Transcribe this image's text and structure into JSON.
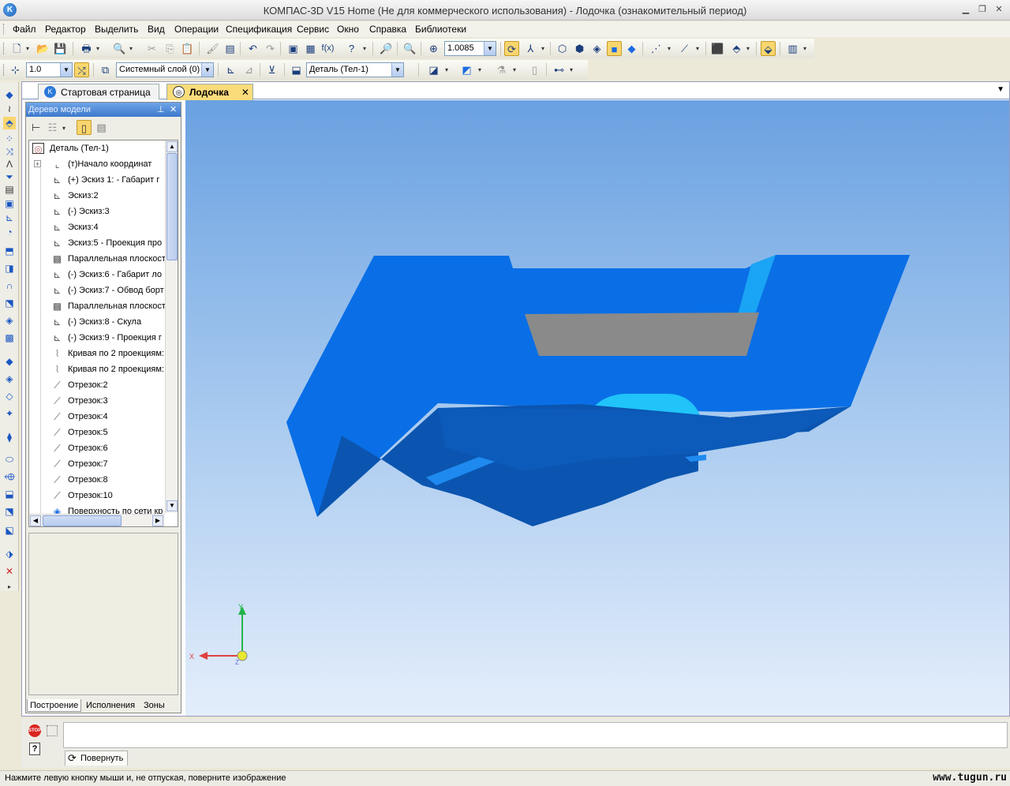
{
  "window": {
    "title": "КОМПАС-3D V15 Home (Не для коммерческого использования) - Лодочка (ознакомительный период)",
    "app_icon": "kompas-logo-icon"
  },
  "menu": [
    "Файл",
    "Редактор",
    "Выделить",
    "Вид",
    "Операции",
    "Спецификация",
    "Сервис",
    "Окно",
    "Справка",
    "Библиотеки"
  ],
  "toolbar1": {
    "zoom_value": "1.0085"
  },
  "toolbar2": {
    "scale_value": "1.0",
    "layer_value": "Системный слой (0)",
    "object_value": "Деталь (Тел-1)"
  },
  "tabs": [
    {
      "label": "Стартовая страница",
      "active": false
    },
    {
      "label": "Лодочка",
      "active": true
    }
  ],
  "tree_panel": {
    "title": "Дерево модели",
    "root": "Деталь (Тел-1)",
    "items": [
      {
        "label": "(т)Начало координат",
        "icon": "axes-icon"
      },
      {
        "label": "(+) Эскиз 1: - Габарит г",
        "icon": "sketch-icon"
      },
      {
        "label": "Эскиз:2",
        "icon": "sketch-icon"
      },
      {
        "label": "(-) Эскиз:3",
        "icon": "sketch-icon"
      },
      {
        "label": "Эскиз:4",
        "icon": "sketch-icon"
      },
      {
        "label": "Эскиз:5 - Проекция про",
        "icon": "sketch-icon"
      },
      {
        "label": "Параллельная плоскост",
        "icon": "plane-icon"
      },
      {
        "label": "(-) Эскиз:6 - Габарит ло",
        "icon": "sketch-icon"
      },
      {
        "label": "(-) Эскиз:7 - Обвод борт",
        "icon": "sketch-icon"
      },
      {
        "label": "Параллельная плоскост",
        "icon": "plane-icon"
      },
      {
        "label": "(-) Эскиз:8 - Скула",
        "icon": "sketch-icon"
      },
      {
        "label": "(-) Эскиз:9 - Проекция г",
        "icon": "sketch-icon"
      },
      {
        "label": "Кривая по 2 проекциям:",
        "icon": "curve-icon"
      },
      {
        "label": "Кривая по 2 проекциям:",
        "icon": "curve-icon"
      },
      {
        "label": "Отрезок:2",
        "icon": "segment-icon"
      },
      {
        "label": "Отрезок:3",
        "icon": "segment-icon"
      },
      {
        "label": "Отрезок:4",
        "icon": "segment-icon"
      },
      {
        "label": "Отрезок:5",
        "icon": "segment-icon"
      },
      {
        "label": "Отрезок:6",
        "icon": "segment-icon"
      },
      {
        "label": "Отрезок:7",
        "icon": "segment-icon"
      },
      {
        "label": "Отрезок:8",
        "icon": "segment-icon"
      },
      {
        "label": "Отрезок:10",
        "icon": "segment-icon"
      },
      {
        "label": "Поверхность по сети кр",
        "icon": "surface-icon"
      }
    ],
    "bottom_tabs": [
      "Построение",
      "Исполнения",
      "Зоны"
    ]
  },
  "axis": {
    "x_label": "X",
    "y_label": "Y",
    "z_label": "Z"
  },
  "command": {
    "rotate_button": "Повернуть",
    "stop_label": "STOP",
    "help_label": "?"
  },
  "status": {
    "text": "Нажмите левую кнопку мыши и, не отпуская, поверните изображение"
  },
  "watermark": "www.tugun.ru",
  "colors": {
    "model_main": "#0a72ea",
    "model_dark": "#0b55b0",
    "model_light": "#1eb8f7",
    "cutout": "#8a8a8a",
    "active_tab": "#fbdc7b"
  }
}
